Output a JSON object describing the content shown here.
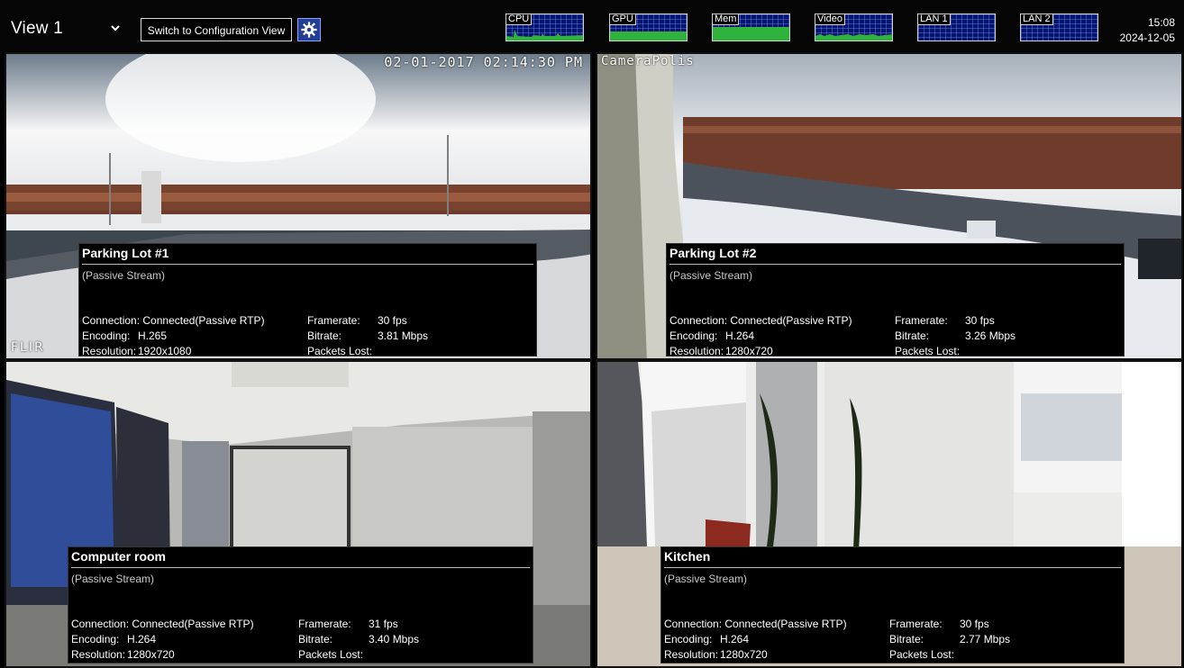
{
  "topbar": {
    "view_title": "View 1",
    "switch_label": "Switch to Configuration View",
    "gear_icon": "gear-icon",
    "time": "15:08",
    "date": "2024-12-05"
  },
  "metrics": [
    {
      "label": "CPU"
    },
    {
      "label": "GPU"
    },
    {
      "label": "Mem"
    },
    {
      "label": "Video"
    },
    {
      "label": "LAN 1"
    },
    {
      "label": "LAN 2"
    }
  ],
  "cameras": [
    {
      "title": "Parking Lot #1",
      "stream": "(Passive Stream)",
      "overlay_timestamp": "02-01-2017 02:14:30 PM",
      "overlay_brand": "FLIR",
      "connection_label": "Connection:",
      "connection": "Connected(Passive RTP)",
      "encoding_label": "Encoding:",
      "encoding": "H.265",
      "resolution_label": "Resolution:",
      "resolution": "1920x1080",
      "framerate_label": "Framerate:",
      "framerate": "30 fps",
      "bitrate_label": "Bitrate:",
      "bitrate": "3.81 Mbps",
      "packets_label": "Packets Lost:",
      "packets": ""
    },
    {
      "title": "Parking Lot #2",
      "stream": "(Passive Stream)",
      "overlay_name": "CameraPolis",
      "connection_label": "Connection:",
      "connection": "Connected(Passive RTP)",
      "encoding_label": "Encoding:",
      "encoding": "H.264",
      "resolution_label": "Resolution:",
      "resolution": "1280x720",
      "framerate_label": "Framerate:",
      "framerate": "30 fps",
      "bitrate_label": "Bitrate:",
      "bitrate": "3.26 Mbps",
      "packets_label": "Packets Lost:",
      "packets": ""
    },
    {
      "title": "Computer room",
      "stream": "(Passive Stream)",
      "connection_label": "Connection:",
      "connection": "Connected(Passive RTP)",
      "encoding_label": "Encoding:",
      "encoding": "H.264",
      "resolution_label": "Resolution:",
      "resolution": "1280x720",
      "framerate_label": "Framerate:",
      "framerate": "31 fps",
      "bitrate_label": "Bitrate:",
      "bitrate": "3.40 Mbps",
      "packets_label": "Packets Lost:",
      "packets": ""
    },
    {
      "title": "Kitchen",
      "stream": "(Passive Stream)",
      "connection_label": "Connection:",
      "connection": "Connected(Passive RTP)",
      "encoding_label": "Encoding:",
      "encoding": "H.264",
      "resolution_label": "Resolution:",
      "resolution": "1280x720",
      "framerate_label": "Framerate:",
      "framerate": "30 fps",
      "bitrate_label": "Bitrate:",
      "bitrate": "2.77 Mbps",
      "packets_label": "Packets Lost:",
      "packets": ""
    }
  ]
}
